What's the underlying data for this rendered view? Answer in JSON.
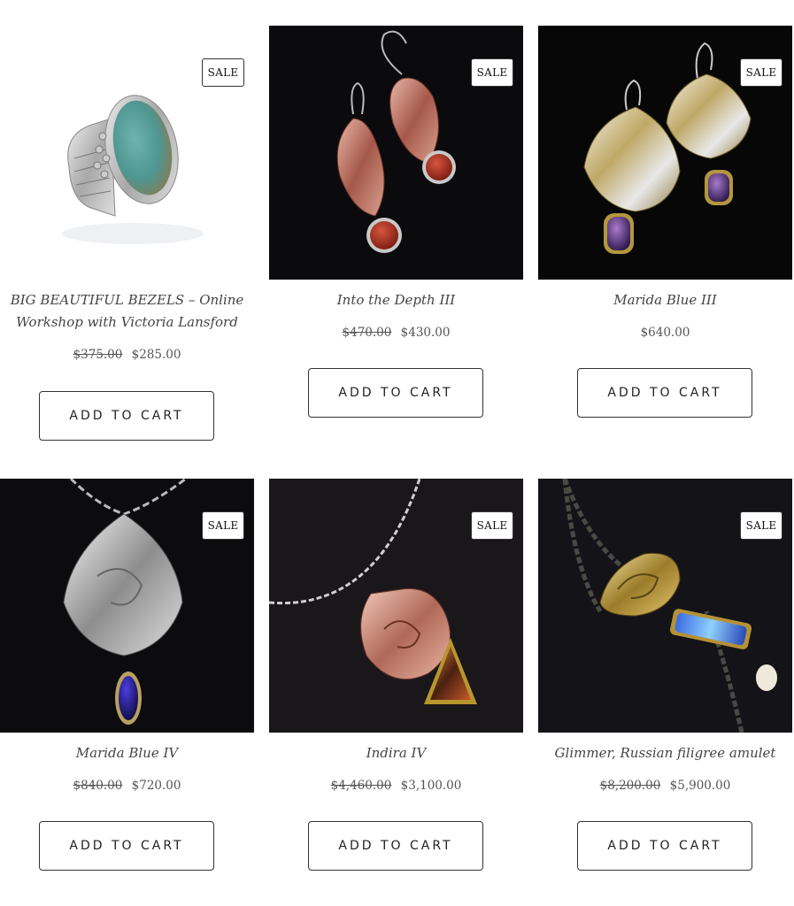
{
  "products": [
    {
      "title": "BIG BEAUTIFUL BEZELS – Online Workshop with Victoria Lansford",
      "badge": "SALE",
      "price_old": "$375.00",
      "price": "$285.00",
      "cta": "ADD TO CART"
    },
    {
      "title": "Into the Depth III",
      "badge": "SALE",
      "price_old": "$470.00",
      "price": "$430.00",
      "cta": "ADD TO CART"
    },
    {
      "title": "Marida Blue III",
      "badge": "SALE",
      "price_old": "",
      "price": "$640.00",
      "cta": "ADD TO CART"
    },
    {
      "title": "Marida Blue IV",
      "badge": "SALE",
      "price_old": "$840.00",
      "price": "$720.00",
      "cta": "ADD TO CART"
    },
    {
      "title": "Indira IV",
      "badge": "SALE",
      "price_old": "$4,460.00",
      "price": "$3,100.00",
      "cta": "ADD TO CART"
    },
    {
      "title": "Glimmer, Russian filigree amulet",
      "badge": "SALE",
      "price_old": "$8,200.00",
      "price": "$5,900.00",
      "cta": "ADD TO CART"
    }
  ]
}
